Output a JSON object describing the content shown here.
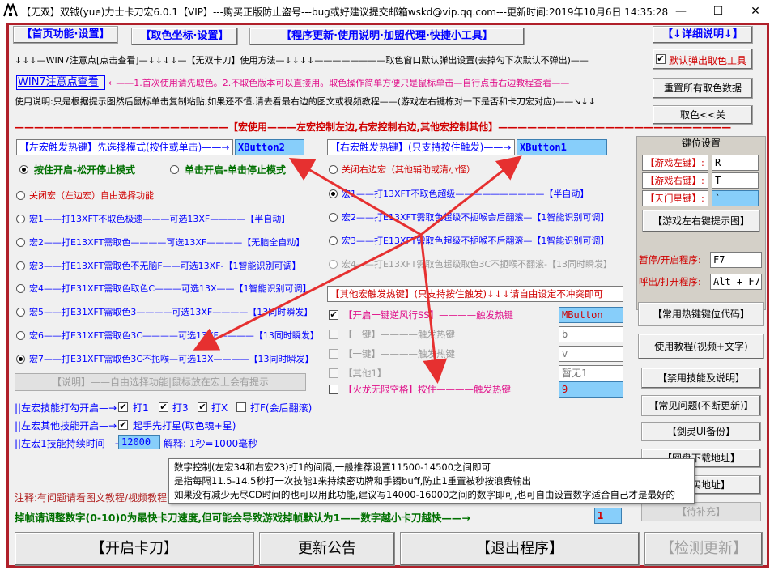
{
  "window": {
    "title": "【无双】双钺(yue)力士卡刀宏6.0.1【VIP】---购买正版防止盗号---bug或好建议提交邮箱wskd@vip.qq.com---更新时间:2019年10月6日 14:35:28",
    "minimize": "—",
    "maximize": "☐",
    "close": "✕"
  },
  "tabs": {
    "home": "【首页功能·设置】",
    "color": "【取色坐标·设置】",
    "update": "【程序更新·使用说明·加盟代理·快捷小工具】",
    "detail": "【↓详细说明↓】"
  },
  "notes": {
    "line1": "↓↓↓—WIN7注意点[点击查看]—↓↓↓↓—【无双卡刀】使用方法—↓↓↓↓————————取色窗口默认弹出设置(去掉勾下次默认不弹出)——",
    "win7_link": "WIN7注意点查看",
    "hint1": "←——1.首次使用请先取色。2.不取色版本可以直接用。取色操作简单方便只是鼠标单击—自行点击右边教程查看——",
    "usage": "使用说明:只是根据提示图然后鼠标单击复制粘贴,如果还不懂,请去看最右边的图文或视频教程——(游戏左右键栋对一下是否和卡刀宏对应)——↘↓↓"
  },
  "right_top": {
    "auto_popup": "默认弹出取色工具",
    "reset_color": "重置所有取色数据",
    "color_close": "取色<<关"
  },
  "macro_header": "——————————————————————【宏使用———左宏控制左边,右宏控制右边,其他宏控制其他】————————————————————————",
  "left": {
    "trigger_label": "【左宏触发热键】先选择模式(按住或单击)——→",
    "trigger_value": "XButton2",
    "mode_hold": "按住开启-松开停止模式",
    "mode_click": "单击开启-单击停止模式",
    "options": [
      "关闭宏（左边宏）自由选择功能",
      "宏1——打13XFT不取色极速———可选13XF————【半自动】",
      "宏2——打E13XFT需取色————可选13XF————【无脑全自动】",
      "宏3——打E13XFT需取色不无脑F——可选13XF-【1智能识别可调】",
      "宏4——打E31XFT需取色取色C———可选13X——【1智能识别可调】",
      "宏5——打E31XFT需取色3————可选13XF————【13同时瞬发】",
      "宏6——打E31XFT需取色3C————可选13XF————【13同时瞬发】",
      "宏7——打E31XFT需取色3C不扼喉—可选13X————【13同时瞬发】"
    ],
    "disabled_btn": "【说明】——自由选择功能|鼠标放在宏上会有提示"
  },
  "right": {
    "trigger_label": "【右宏触发热键】(只支持按住触发)——→",
    "trigger_value": "XButton1",
    "options": [
      "关闭右边宏（其他辅助或清小怪）",
      "宏1——打13XFT不取色超级——————————【半自动】",
      "宏2——打E13XFT需取色超级不扼喉会后翻滚—【1智能识别可调】",
      "宏3——打E13XFT需取色超级不扼喉不后翻滚—【1智能识别可调】",
      "宏4——打E13XFT需取色超级取色3C不扼喉不翻滚-【13同时瞬发】"
    ]
  },
  "other": {
    "header": "【其他宏触发热键】(只支持按住触发)↓↓↓请自由设定不冲突即可",
    "rows": [
      {
        "label": "【开启一键逆风行SS】————触发热键",
        "value": "MButton",
        "checked": "✔"
      },
      {
        "label": "【一键】————触发热键",
        "value": "b",
        "checked": ""
      },
      {
        "label": "【一键】————触发热键",
        "value": "v",
        "checked": ""
      },
      {
        "label": "【其他1】",
        "value": "暂无1",
        "checked": ""
      },
      {
        "label": "【火龙无限空格】按住————触发热键",
        "value": "9",
        "checked": ""
      }
    ]
  },
  "keypanel": {
    "title": "键位设置",
    "game_left_label": "【游戏左键】:",
    "game_left_value": "R",
    "game_right_label": "【游戏右键】:",
    "game_right_value": "T",
    "star_label": "【天门星键】:",
    "star_value": "`",
    "hint_btn": "【游戏左右键提示图】",
    "pause_label": "暂停/开启程序:",
    "pause_value": "F7",
    "exit_label": "呼出/打开程序:",
    "exit_value": "Alt + F7"
  },
  "side_buttons": {
    "hotkey_code": "【常用热键键位代码】",
    "tutorial": "使用教程(视频+文字)",
    "ban_skill": "【禁用技能及说明】",
    "faq": "【常见问题(不断更新)】",
    "backup": "【剑灵UI备份】",
    "download": "【网盘下载地址】",
    "buy": "【购买地址】",
    "pending": "【待补充】"
  },
  "skills": {
    "row1_label": "||左宏技能打勾开启—→",
    "c1": "打1",
    "c2": "打3",
    "c3": "打X",
    "c4": "打F(会后翻滚)",
    "row2_label": "||左宏其他技能开启—→",
    "c5": "起手先打星(取色魂+星)",
    "row3_label": "||左宏1技能持续时间—→",
    "duration": "12000",
    "explain": "解释: 1秒=1000毫秒"
  },
  "tooltip": {
    "l1": "数字控制(左宏34和右宏23)打1的间隔,一般推荐设置11500-14500之间即可",
    "l2": "是指每隔11.5-14.5秒打一次技能1来持续密功牌和手镯buff,防止1重置被秒按浪费输出",
    "l3": "如果没有减少无尽CD时间的也可以用此功能,建议写14000-16000之间的数字即可,也可自由设置数字适合自己才是最好的"
  },
  "footer": {
    "note": "注释:有问题请看图文教程/视频教程",
    "frame_label": "掉帧请调整数字(0-10)0为最快卡刀速度,但可能会导致游戏掉帧默认为1——数字越小卡刀越快——→",
    "frame_value": "1"
  },
  "bottom": {
    "start": "【开启卡刀】",
    "notice": "更新公告",
    "exit": "【退出程序】",
    "check": "【检测更新】"
  }
}
